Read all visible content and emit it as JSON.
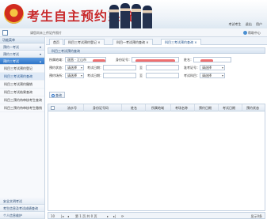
{
  "header": {
    "title": "考生自主预约系统",
    "user_label": "考试考生",
    "role_label": "退出",
    "user_name": "用户"
  },
  "strip": {
    "text": "请您尚未上传证件照片",
    "right_label": "帮助中心"
  },
  "sidebar": {
    "head": "功能菜单",
    "groups": [
      {
        "label": "预约一考试",
        "icon": "arrow-icon"
      },
      {
        "label": "预约二考试",
        "icon": "arrow-icon"
      },
      {
        "label": "预约三考试",
        "icon": "arrow-icon",
        "active": true
      }
    ],
    "items": [
      {
        "label": "科目三考试预约登记"
      },
      {
        "label": "科目三考试预约查询",
        "selected": true
      },
      {
        "label": "科目三考试预约撤销"
      },
      {
        "label": "科目三考试结果查询"
      },
      {
        "label": "科目三预约待审核考生查询"
      },
      {
        "label": "科目三预约待审核考生撤销"
      }
    ],
    "bottom_groups": [
      {
        "label": "安全文明考试"
      },
      {
        "label": "考生信息及考试成绩查询"
      },
      {
        "label": "个人信息维护"
      }
    ]
  },
  "tabs": [
    {
      "label": "首页"
    },
    {
      "label": "科目三考试预约登记 ×"
    },
    {
      "label": "科目一考试预约查询 ×"
    },
    {
      "label": "科目三考试预约查询 ×",
      "active": true
    }
  ],
  "panel_title": "科目三考试预约查询",
  "form": {
    "row1": {
      "l1": "所属地域：",
      "v1": "遂昌 - 江山市",
      "l2": "身份证号：",
      "l3": "姓名："
    },
    "row2": {
      "l1": "预约状态：",
      "v1": "请选择",
      "l2": "考试日期：",
      "sep": "至",
      "l3": "准考证号：",
      "v3": "请选择"
    },
    "row3": {
      "l1": "预约场所：",
      "v1": "请选择",
      "l2": "考试日期：",
      "sep": "至",
      "l3": "考试科目：",
      "v3": "请选择"
    }
  },
  "search_button": "查询",
  "table": {
    "columns": [
      "流水号",
      "身份证号码",
      "姓名",
      "所属地域",
      "考场名称",
      "预约日期",
      "考试日期",
      "预约状态"
    ]
  },
  "pager": {
    "page_size": "10",
    "nav": "第 1 页 共 0 页",
    "summary": "显示0条"
  }
}
